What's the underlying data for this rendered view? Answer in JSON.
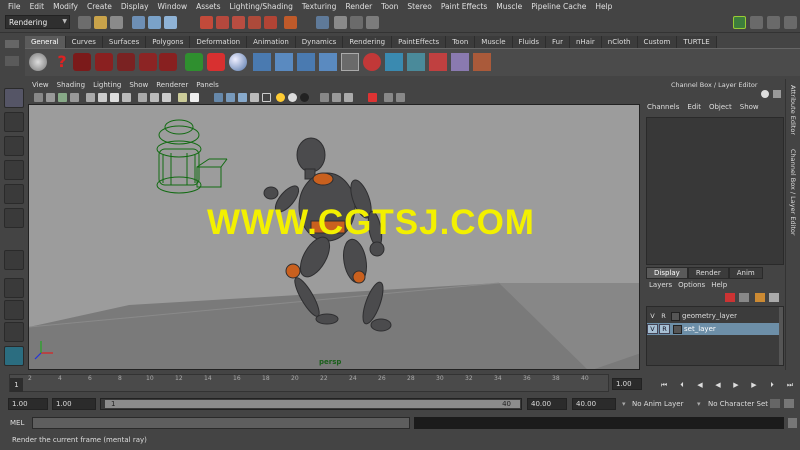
{
  "menubar": {
    "items": [
      "File",
      "Edit",
      "Modify",
      "Create",
      "Display",
      "Window",
      "Assets",
      "Lighting/Shading",
      "Texturing",
      "Render",
      "Toon",
      "Stereo",
      "Paint Effects",
      "Muscle",
      "Pipeline Cache",
      "Help"
    ]
  },
  "statusline": {
    "mode_dropdown": "Rendering"
  },
  "shelf": {
    "tabs": [
      "General",
      "Curves",
      "Surfaces",
      "Polygons",
      "Deformation",
      "Animation",
      "Dynamics",
      "Rendering",
      "PaintEffects",
      "Toon",
      "Muscle",
      "Fluids",
      "Fur",
      "nHair",
      "nCloth",
      "Custom",
      "TURTLE"
    ],
    "active_tab": "General"
  },
  "viewport": {
    "menu": [
      "View",
      "Shading",
      "Lighting",
      "Show",
      "Renderer",
      "Panels"
    ],
    "camera_label": "persp",
    "watermark": "WWW.CGTSJ.COM",
    "background_color": "#9c9c9c"
  },
  "channelbox": {
    "title": "Channel Box / Layer Editor",
    "menu": [
      "Channels",
      "Edit",
      "Object",
      "Show"
    ]
  },
  "layereditor": {
    "tabs": [
      "Display",
      "Render",
      "Anim"
    ],
    "active_tab": "Display",
    "menu": [
      "Layers",
      "Options",
      "Help"
    ],
    "layers": [
      {
        "v": "V",
        "r": "R",
        "name": "geometry_layer",
        "selected": false
      },
      {
        "v": "V",
        "r": "R",
        "name": "set_layer",
        "selected": true
      }
    ]
  },
  "sidestrip": {
    "attribute_editor": "Attribute Editor",
    "channel_box_tab": "Channel Box / Layer Editor"
  },
  "timeslider": {
    "current_frame": "1",
    "ticks": [
      "2",
      "4",
      "6",
      "8",
      "10",
      "12",
      "14",
      "16",
      "18",
      "20",
      "22",
      "24",
      "26",
      "28",
      "30",
      "32",
      "34",
      "36",
      "38",
      "40"
    ],
    "current_time_field": "1.00"
  },
  "rangebar": {
    "start_time": "1.00",
    "playback_start": "1.00",
    "range_min_label": "1",
    "range_max_label": "40",
    "playback_end": "40.00",
    "end_time": "40.00",
    "anim_layer": "No Anim Layer",
    "character_set": "No Character Set"
  },
  "commandline": {
    "label": "MEL",
    "help_text": "Render the current frame (mental ray)"
  }
}
